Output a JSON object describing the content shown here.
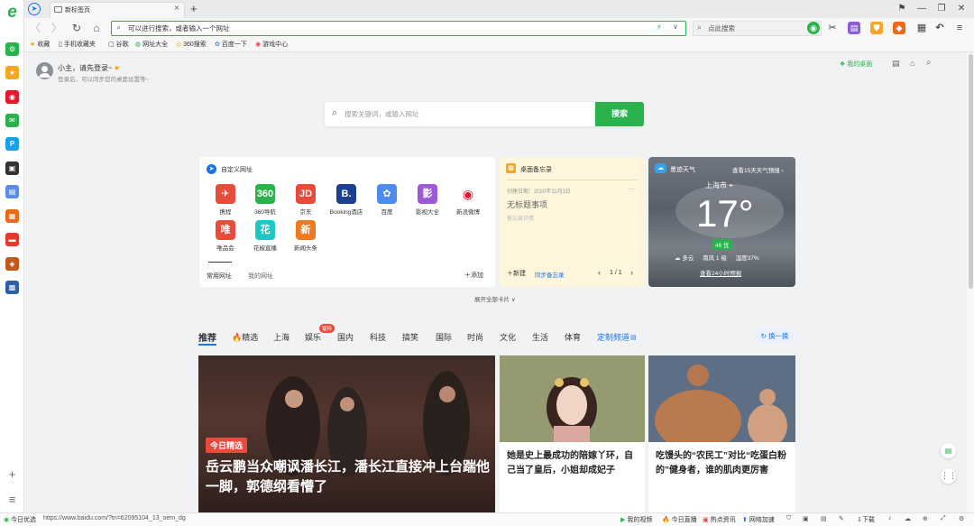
{
  "sidebar": {
    "logo": "e",
    "apps": [
      {
        "name": "app-green",
        "color": "#2bb24c",
        "glyph": "⚙"
      },
      {
        "name": "app-favorites",
        "color": "#f5a623",
        "glyph": "★"
      },
      {
        "name": "app-weibo",
        "color": "#e6162d",
        "glyph": "◉"
      },
      {
        "name": "app-mail",
        "color": "#2bb24c",
        "glyph": "✉"
      },
      {
        "name": "app-p",
        "color": "#1aa0e8",
        "glyph": "P"
      },
      {
        "name": "app-game1",
        "color": "#333",
        "glyph": "▣"
      },
      {
        "name": "app-doc",
        "color": "#5a8de8",
        "glyph": "▤"
      },
      {
        "name": "app-game2",
        "color": "#e86a1a",
        "glyph": "▦"
      },
      {
        "name": "app-red",
        "color": "#e63a2e",
        "glyph": "▬"
      },
      {
        "name": "app-game3",
        "color": "#c0591a",
        "glyph": "◈"
      },
      {
        "name": "app-game4",
        "color": "#2c5fa8",
        "glyph": "▩"
      }
    ],
    "add": "+",
    "menu": "≡"
  },
  "tab": {
    "title": "新标签页",
    "close": "×",
    "new": "+"
  },
  "window_buttons": [
    "⚑",
    "—",
    "❐",
    "✕"
  ],
  "toolbar": {
    "address_placeholder": "可以进行搜索，或者输入一个网址",
    "search_placeholder": "点此搜索"
  },
  "bookmarks": [
    "收藏",
    "手机收藏夹",
    "谷歌",
    "网址大全",
    "360搜索",
    "百度一下",
    "游戏中心"
  ],
  "user": {
    "greeting": "小主，请先登录~",
    "sub": "登录后，可以同步您的桌面设置等~"
  },
  "top_right": {
    "my_desktop": "我的桌面"
  },
  "main_search": {
    "placeholder": "搜索关键词，或输入网址",
    "button": "搜索"
  },
  "sites_card": {
    "title": "自定义网址",
    "items": [
      {
        "label": "携程",
        "color": "#e84a3c",
        "glyph": "✈"
      },
      {
        "label": "360导航",
        "color": "#2bb24c",
        "glyph": "360"
      },
      {
        "label": "京东",
        "color": "#e84a3c",
        "glyph": "JD"
      },
      {
        "label": "Booking酒店",
        "color": "#1d3f8f",
        "glyph": "B."
      },
      {
        "label": "百度",
        "color": "#4e8bf0",
        "glyph": "✿"
      },
      {
        "label": "影视大全",
        "color": "#9b59d6",
        "glyph": "影"
      },
      {
        "label": "新浪微博",
        "color": "#ffffff",
        "glyph": "◉"
      },
      {
        "label": "唯品会",
        "color": "#e84a3c",
        "glyph": "唯"
      },
      {
        "label": "花椒直播",
        "color": "#1ec6c6",
        "glyph": "花"
      },
      {
        "label": "新闻头条",
        "color": "#f07a22",
        "glyph": "新"
      }
    ],
    "tabs": [
      "常用网址",
      "我的网址"
    ],
    "add": "添加"
  },
  "notes_card": {
    "title": "桌面备忘录",
    "date": "创建日期：2020年11月3日",
    "heading": "无标题事项",
    "hint": "备忘录详情",
    "new": "新建",
    "sync": "同步备忘录",
    "page": "1 / 1"
  },
  "weather": {
    "title": "墨迹天气",
    "forecast_link": "查看15天天气预报",
    "city": "上海市",
    "temp": "17°",
    "aqi": "46 优",
    "cond": "多云",
    "wind": "南风 1 级",
    "humidity": "湿度37%",
    "hourly": "查看24小时预报"
  },
  "expand_all": "展开全部卡片",
  "news_tabs": [
    "推荐",
    "🔥精选",
    "上海",
    "娱乐",
    "国内",
    "科技",
    "搞笑",
    "国际",
    "时尚",
    "文化",
    "生活",
    "体育",
    "定制频道"
  ],
  "hot_badge": "猛料",
  "refresh": "换一换",
  "news": [
    {
      "tag": "今日精选",
      "title": "岳云鹏当众嘲讽潘长江，潘长江直接冲上台踹他一脚，郭德纲看懵了"
    },
    {
      "title": "她是史上最成功的陪嫁丫环，自己当了皇后，小姐却成妃子"
    },
    {
      "title": "吃馒头的“农民工”对比“吃蛋白粉的”健身者，谁的肌肉更厉害"
    }
  ],
  "status": {
    "left": "今日优选",
    "url": "https://www.baidu.com/?tn=62095104_13_oem_dg",
    "right": [
      "我的视频",
      "今日直播",
      "热点资讯",
      "网络加速"
    ],
    "download": "下载"
  },
  "colors": {
    "brand": "#2bb24c",
    "link": "#1a73e8",
    "accent": "#e84a3c"
  }
}
